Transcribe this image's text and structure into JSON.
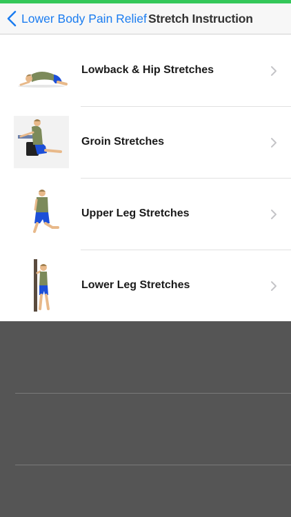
{
  "navbar": {
    "back_label": "Lower Body Pain Relief",
    "title": "Stretch Instruction"
  },
  "rows": [
    {
      "label": "Lowback & Hip Stretches",
      "icon": "lowback-hip-stretch-figure"
    },
    {
      "label": "Groin Stretches",
      "icon": "groin-stretch-figure"
    },
    {
      "label": "Upper Leg Stretches",
      "icon": "upper-leg-stretch-figure"
    },
    {
      "label": "Lower Leg Stretches",
      "icon": "lower-leg-stretch-figure"
    }
  ],
  "colors": {
    "accent": "#1a7cf0",
    "status_strip": "#34c759",
    "background_empty": "#555555",
    "shirt": "#7c8a5a",
    "shorts": "#1c4fd8",
    "skin": "#e8b98a"
  }
}
